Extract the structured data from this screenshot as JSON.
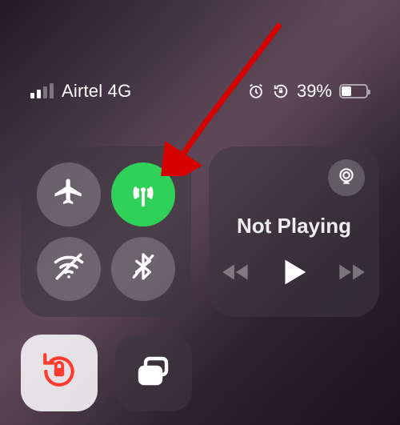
{
  "status": {
    "carrier": "Airtel 4G",
    "battery_pct": "39%",
    "battery_fill_pct": 39
  },
  "media": {
    "title": "Not Playing"
  },
  "colors": {
    "active_green": "#30d158",
    "lock_red": "#ff3b30"
  }
}
